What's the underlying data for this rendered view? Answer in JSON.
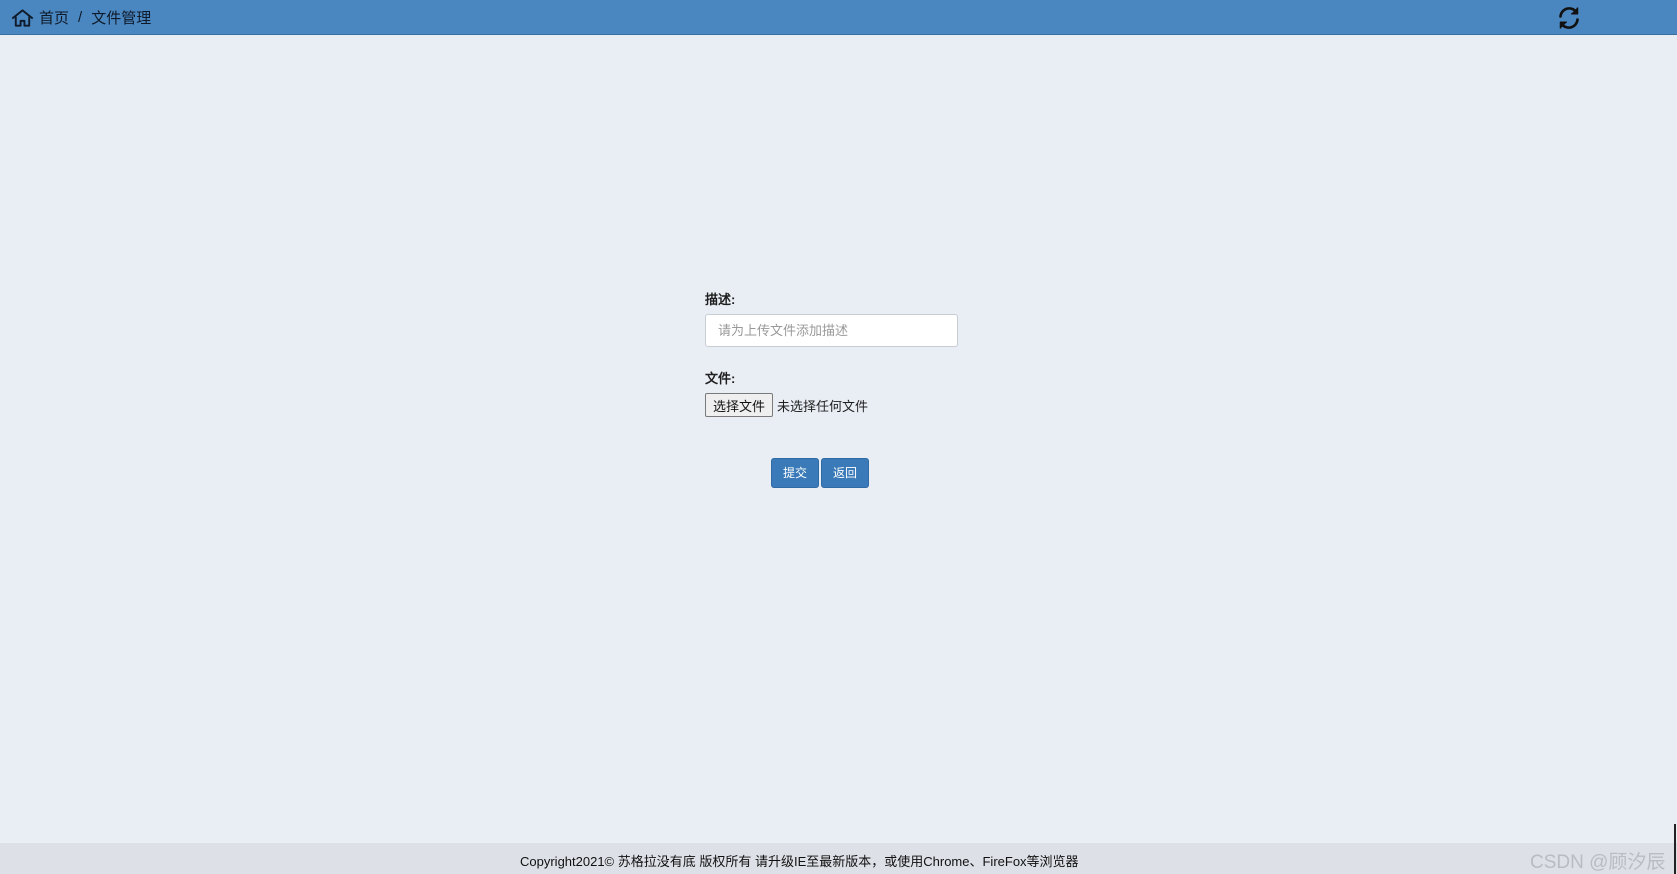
{
  "breadcrumb": {
    "home_label": "首页",
    "separator": "/",
    "current_label": "文件管理"
  },
  "icons": {
    "home": "home-icon",
    "refresh": "refresh-icon"
  },
  "form": {
    "description_label": "描述:",
    "description_placeholder": "请为上传文件添加描述",
    "description_value": "",
    "file_label": "文件:",
    "file_button_label": "选择文件",
    "file_status": "未选择任何文件"
  },
  "actions": {
    "submit_label": "提交",
    "back_label": "返回"
  },
  "footer": {
    "copyright": "Copyright2021© 苏格拉没有底 版权所有 请升级IE至最新版本，或使用Chrome、FireFox等浏览器",
    "watermark": "CSDN @顾汐辰"
  },
  "colors": {
    "topbar": "#4a86c0",
    "background": "#e9edf4",
    "button": "#3a7ab8",
    "footer": "#dde0e6"
  }
}
